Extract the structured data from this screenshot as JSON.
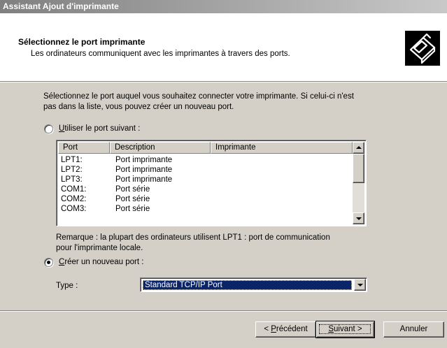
{
  "window": {
    "title": "Assistant Ajout d'imprimante"
  },
  "header": {
    "title": "Sélectionnez le port imprimante",
    "subtitle": "Les ordinateurs communiquent avec les imprimantes à travers des ports.",
    "icon": "printer-port-icon"
  },
  "body": {
    "intro_line1": "Sélectionnez le port auquel vous souhaitez connecter votre imprimante. Si celui-ci n'est",
    "intro_line2": "pas dans la liste, vous pouvez créer un nouveau port.",
    "use_port_radio": {
      "accesskey": "U",
      "rest": "tiliser le port suivant :",
      "checked": false
    },
    "port_list": {
      "columns": [
        "Port",
        "Description",
        "Imprimante"
      ],
      "rows": [
        {
          "port": "LPT1:",
          "description": "Port imprimante",
          "printer": ""
        },
        {
          "port": "LPT2:",
          "description": "Port imprimante",
          "printer": ""
        },
        {
          "port": "LPT3:",
          "description": "Port imprimante",
          "printer": ""
        },
        {
          "port": "COM1:",
          "description": "Port série",
          "printer": ""
        },
        {
          "port": "COM2:",
          "description": "Port série",
          "printer": ""
        },
        {
          "port": "COM3:",
          "description": "Port série",
          "printer": ""
        }
      ]
    },
    "note_line1": "Remarque : la plupart des ordinateurs utilisent LPT1 : port de communication",
    "note_line2": "pour l'imprimante locale.",
    "create_port_radio": {
      "accesskey": "C",
      "rest": "réer un nouveau port :",
      "checked": true
    },
    "type_label": "Type :",
    "type_value": "Standard TCP/IP Port"
  },
  "buttons": {
    "back": {
      "prefix": "< ",
      "accesskey": "P",
      "rest": "récédent"
    },
    "next": {
      "accesskey": "S",
      "rest": "uivant >"
    },
    "cancel": "Annuler"
  }
}
